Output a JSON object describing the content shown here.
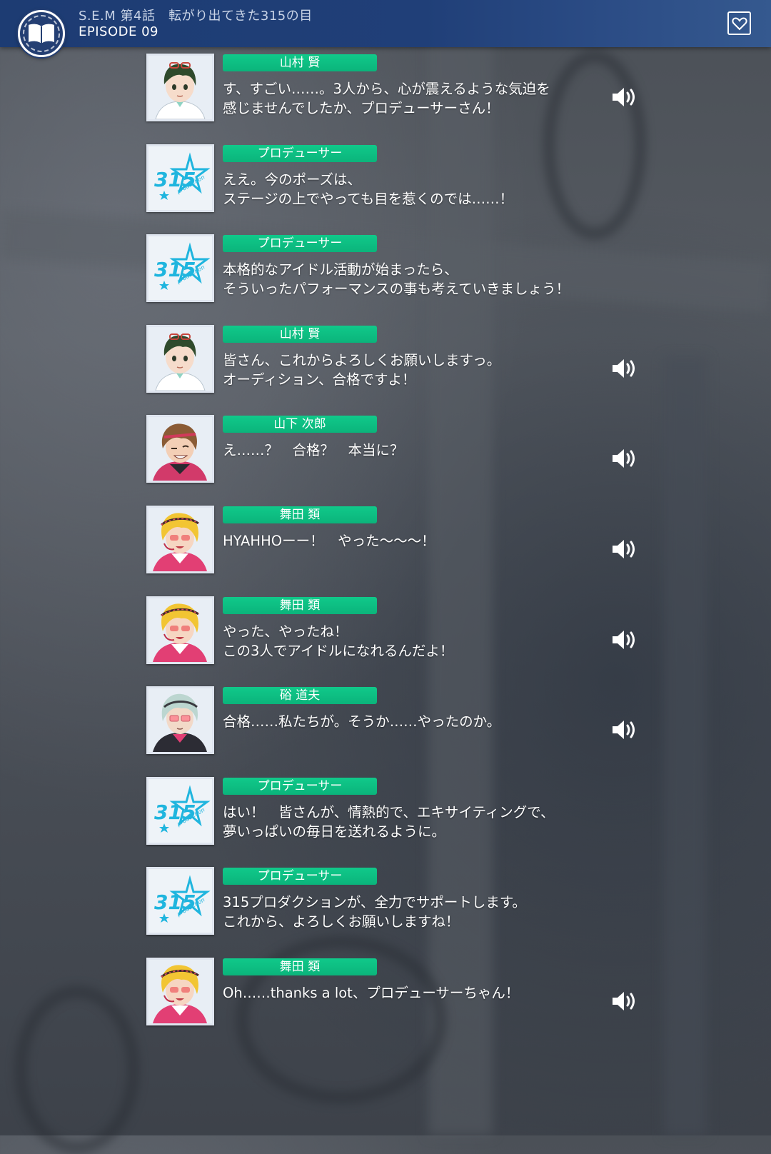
{
  "header": {
    "title": "S.E.M 第4話　転がり出てきた315の目",
    "episode": "EPISODE 09",
    "book_icon": "book-icon",
    "favorite_icon": "heart-icon"
  },
  "colors": {
    "header_bar": "#203f78",
    "name_tag": "#0fc287",
    "text": "#ffffff"
  },
  "log": [
    {
      "speaker": "山村 賢",
      "avatar": "kento",
      "line1": "す、すごい……。3人から、心が震えるような気迫を",
      "line2": "感じませんでしたか、プロデューサーさん！",
      "voice": true
    },
    {
      "speaker": "プロデューサー",
      "avatar": "315-logo",
      "line1": "ええ。今のポーズは、",
      "line2": "ステージの上でやっても目を惹くのでは……！",
      "voice": false
    },
    {
      "speaker": "プロデューサー",
      "avatar": "315-logo",
      "line1": "本格的なアイドル活動が始まったら、",
      "line2": "そういったパフォーマンスの事も考えていきましょう！",
      "voice": false
    },
    {
      "speaker": "山村 賢",
      "avatar": "kento",
      "line1": "皆さん、これからよろしくお願いしますっ。",
      "line2": "オーディション、合格ですよ！",
      "voice": true
    },
    {
      "speaker": "山下 次郎",
      "avatar": "jiro",
      "line1": "え……？　合格？　本当に？",
      "line2": "",
      "voice": true
    },
    {
      "speaker": "舞田 類",
      "avatar": "rui",
      "line1": "HYAHHOーー！　やった〜〜〜！",
      "line2": "",
      "voice": true
    },
    {
      "speaker": "舞田 類",
      "avatar": "rui",
      "line1": "やった、やったね！",
      "line2": "この3人でアイドルになれるんだよ！",
      "voice": true
    },
    {
      "speaker": "硲 道夫",
      "avatar": "michio",
      "line1": "合格……私たちが。そうか……やったのか。",
      "line2": "",
      "voice": true
    },
    {
      "speaker": "プロデューサー",
      "avatar": "315-logo",
      "line1": "はい！　皆さんが、情熱的で、エキサイティングで、",
      "line2": "夢いっぱいの毎日を送れるように。",
      "voice": false
    },
    {
      "speaker": "プロデューサー",
      "avatar": "315-logo",
      "line1": "315プロダクションが、全力でサポートします。",
      "line2": "これから、よろしくお願いしますね！",
      "voice": false
    },
    {
      "speaker": "舞田 類",
      "avatar": "rui",
      "line1": "Oh……thanks a lot、プロデューサーちゃん！",
      "line2": "",
      "voice": true
    }
  ],
  "logo_text": "315 production",
  "voice_icon": "speaker-icon"
}
